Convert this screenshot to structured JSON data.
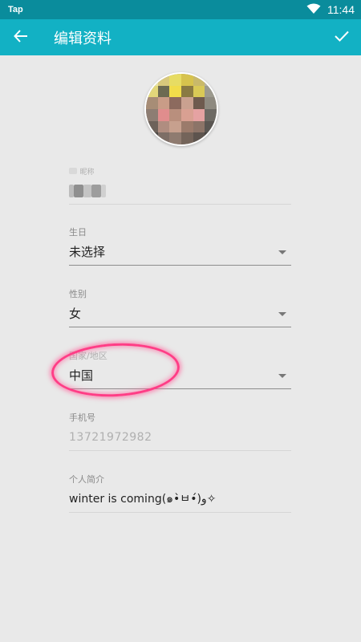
{
  "status_bar": {
    "app_name": "Tap",
    "time": "11:44",
    "wifi_icon": "wifi-icon",
    "battery_icon": "battery-icon"
  },
  "app_bar": {
    "title": "编辑资料",
    "back_icon": "arrow-back-icon",
    "confirm_icon": "check-icon",
    "background": "#12b1c4"
  },
  "fields": {
    "nickname": {
      "label": "昵称",
      "value": ""
    },
    "birthday": {
      "label": "生日",
      "value": "未选择"
    },
    "gender": {
      "label": "性别",
      "value": "女"
    },
    "region": {
      "label": "国家/地区",
      "value": "中国"
    },
    "phone": {
      "label": "手机号",
      "value": "13721972982"
    },
    "bio": {
      "label": "个人简介",
      "value": "winter is coming(๑•̀ㅂ•́)و✧"
    }
  },
  "colors": {
    "annotation": "#ff3d86",
    "background": "#e9e9e9"
  }
}
